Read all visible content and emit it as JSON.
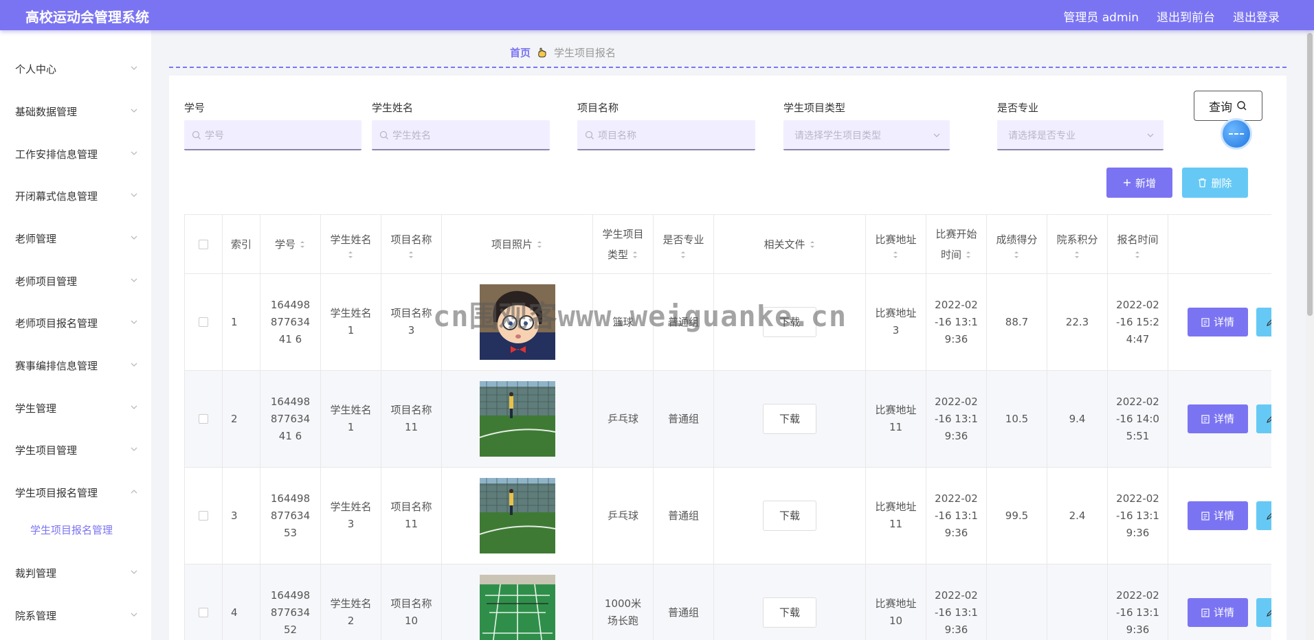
{
  "header": {
    "title": "高校运动会管理系统",
    "user": "管理员 admin",
    "front_link": "退出到前台",
    "logout_link": "退出登录"
  },
  "sidebar": {
    "items": [
      {
        "label": "个人中心"
      },
      {
        "label": "基础数据管理"
      },
      {
        "label": "工作安排信息管理"
      },
      {
        "label": "开闭幕式信息管理"
      },
      {
        "label": "老师管理"
      },
      {
        "label": "老师项目管理"
      },
      {
        "label": "老师项目报名管理"
      },
      {
        "label": "赛事编排信息管理"
      },
      {
        "label": "学生管理"
      },
      {
        "label": "学生项目管理"
      },
      {
        "label": "学生项目报名管理",
        "expanded": true
      },
      {
        "label": "裁判管理"
      },
      {
        "label": "院系管理"
      }
    ],
    "submenu": {
      "label": "学生项目报名管理"
    }
  },
  "breadcrumb": {
    "home": "首页",
    "current": "学生项目报名"
  },
  "filters": {
    "student_no": {
      "label": "学号",
      "placeholder": "学号"
    },
    "student_name": {
      "label": "学生姓名",
      "placeholder": "学生姓名"
    },
    "project_name": {
      "label": "项目名称",
      "placeholder": "项目名称"
    },
    "project_type": {
      "label": "学生项目类型",
      "placeholder": "请选择学生项目类型"
    },
    "is_professional": {
      "label": "是否专业",
      "placeholder": "请选择是否专业"
    }
  },
  "buttons": {
    "query": "查询",
    "add": "新增",
    "delete": "删除",
    "detail": "详情",
    "download": "下载"
  },
  "table": {
    "headers": {
      "index": "索引",
      "student_no": "学号",
      "student_name": "学生姓名",
      "project_name": "项目名称",
      "photo": "项目照片",
      "project_type": "学生项目类型",
      "professional": "是否专业",
      "files": "相关文件",
      "address": "比赛地址",
      "start_time": "比赛开始时间",
      "score": "成绩得分",
      "points": "院系积分",
      "signup_time": "报名时间"
    },
    "rows": [
      {
        "index": "1",
        "student_no": "16449887763441 6",
        "student_name": "学生姓名1",
        "project_name": "项目名称3",
        "photo": "cartoon",
        "project_type": "篮球",
        "professional": "普通组",
        "address": "比赛地址3",
        "start_time": "2022-02-16 13:19:36",
        "score": "88.7",
        "points": "22.3",
        "signup_time": "2022-02-16 15:24:47"
      },
      {
        "index": "2",
        "student_no": "16449887763441 6",
        "student_name": "学生姓名1",
        "project_name": "项目名称11",
        "photo": "field",
        "project_type": "乒乓球",
        "professional": "普通组",
        "address": "比赛地址11",
        "start_time": "2022-02-16 13:19:36",
        "score": "10.5",
        "points": "9.4",
        "signup_time": "2022-02-16 14:05:51"
      },
      {
        "index": "3",
        "student_no": "16449887763453",
        "student_name": "学生姓名3",
        "project_name": "项目名称11",
        "photo": "field",
        "project_type": "乒乓球",
        "professional": "普通组",
        "address": "比赛地址11",
        "start_time": "2022-02-16 13:19:36",
        "score": "99.5",
        "points": "2.4",
        "signup_time": "2022-02-16 13:19:36"
      },
      {
        "index": "4",
        "student_no": "16449887763452",
        "student_name": "学生姓名2",
        "project_name": "项目名称10",
        "photo": "court",
        "project_type": "1000米场长跑",
        "professional": "普通组",
        "address": "比赛地址10",
        "start_time": "2022-02-16 13:19:36",
        "score": "",
        "points": "",
        "signup_time": "2022-02-16 13:19:36"
      }
    ]
  },
  "watermark": "cn围观客www.weiguanke.cn",
  "colors": {
    "primary": "#7b74f2",
    "info": "#66c9f5",
    "input_bg": "#f1efff"
  }
}
